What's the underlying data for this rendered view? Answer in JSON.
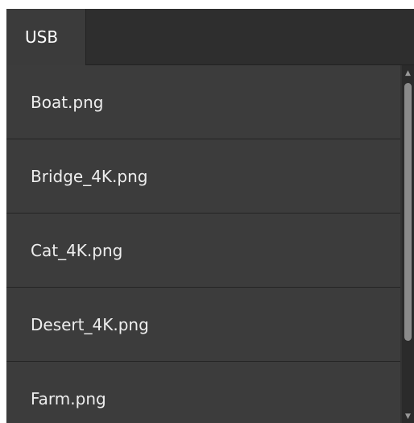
{
  "tabs": [
    {
      "label": "USB"
    }
  ],
  "files": [
    {
      "name": "Boat.png"
    },
    {
      "name": "Bridge_4K.png"
    },
    {
      "name": "Cat_4K.png"
    },
    {
      "name": "Desert_4K.png"
    },
    {
      "name": "Farm.png"
    }
  ],
  "scrollbar": {
    "up_arrow": "▲",
    "down_arrow": "▼"
  },
  "colors": {
    "panel": "#333333",
    "item": "#3c3c3c",
    "text": "#eeeeee",
    "thumb": "#8a8a8a"
  }
}
